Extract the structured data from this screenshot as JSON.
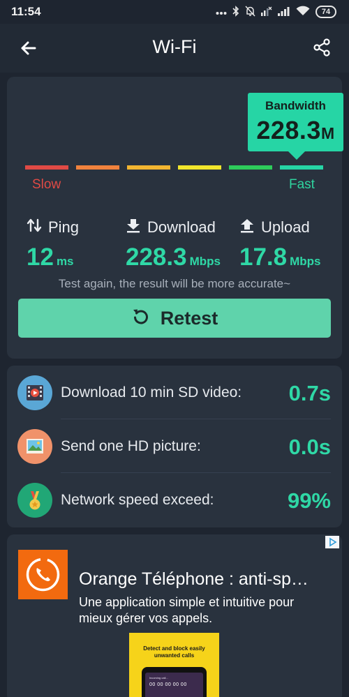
{
  "status_bar": {
    "time": "11:54",
    "battery": "74",
    "icons": [
      "more-dots-icon",
      "bluetooth-icon",
      "mute-bell-icon",
      "signal-x-icon",
      "signal-icon",
      "wifi-icon",
      "battery-icon"
    ]
  },
  "app_bar": {
    "title": "Wi-Fi",
    "back_icon": "arrow-left-icon",
    "share_icon": "share-icon"
  },
  "bandwidth": {
    "label": "Bandwidth",
    "value": "228.3",
    "unit": "M"
  },
  "scale": {
    "slow": "Slow",
    "fast": "Fast",
    "segment_colors": [
      "#e04a45",
      "#f0823d",
      "#f2b531",
      "#f1e52c",
      "#2ecc5b",
      "#26d5a5"
    ]
  },
  "metrics": {
    "ping": {
      "label": "Ping",
      "value": "12",
      "unit": "ms"
    },
    "download": {
      "label": "Download",
      "value": "228.3",
      "unit": "Mbps"
    },
    "upload": {
      "label": "Upload",
      "value": "17.8",
      "unit": "Mbps"
    }
  },
  "hint": "Test again, the result will be more accurate~",
  "retest": {
    "label": "Retest"
  },
  "results": [
    {
      "label": "Download 10 min SD video:",
      "value": "0.7s",
      "icon": "video-icon",
      "icon_bg": "#5aa7d6"
    },
    {
      "label": "Send one HD picture:",
      "value": "0.0s",
      "icon": "picture-icon",
      "icon_bg": "#f0926a"
    },
    {
      "label": "Network speed exceed:",
      "value": "99%",
      "icon": "medal-icon",
      "icon_bg": "#21a776"
    }
  ],
  "ad": {
    "title": "Orange Téléphone : anti-sp…",
    "description": "Une application simple et intuitive pour mieux gérer vos appels.",
    "screenshot_text": "Detect and block easily unwanted calls",
    "screenshot_call_label": "Incoming call...",
    "screenshot_number": "00 00 00 00 00",
    "brand_color": "#f26a0f",
    "adchoices_icon": "adchoices-icon"
  },
  "colors": {
    "background": "#1e2530",
    "card": "#29323e",
    "accent": "#2fd8a6",
    "button": "#5fd3ab"
  }
}
